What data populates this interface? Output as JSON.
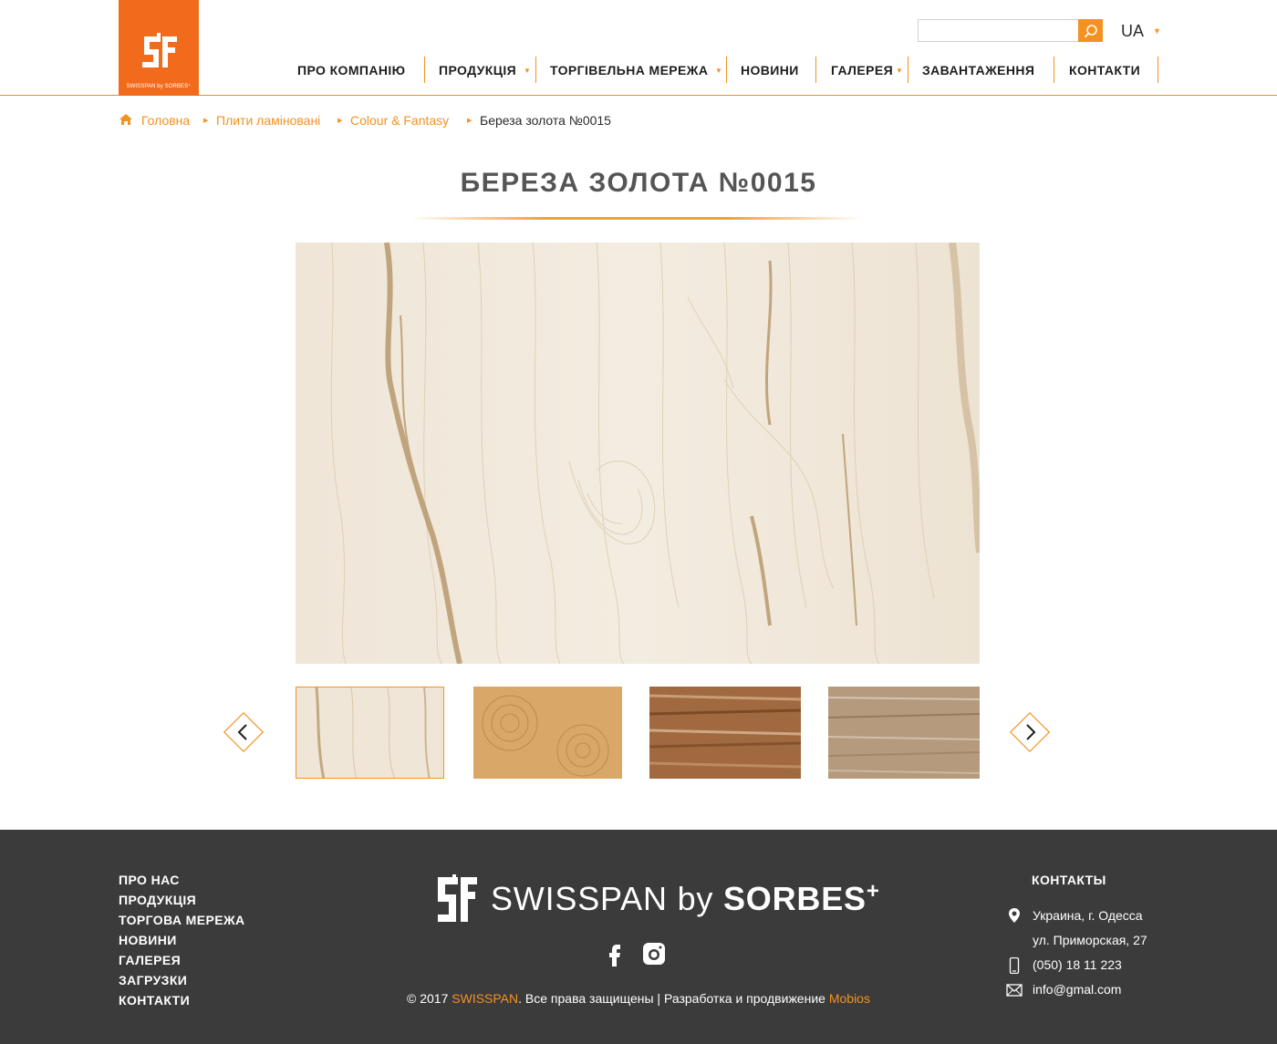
{
  "header": {
    "logo_caption": "SWISSPAN by SORBES⁺",
    "search_placeholder": "",
    "language": "UA",
    "nav": [
      {
        "label": "ПРО КОМПАНІЮ"
      },
      {
        "label": "ПРОДУКЦІЯ"
      },
      {
        "label": "ТОРГІВЕЛЬНА МЕРЕЖА"
      },
      {
        "label": "НОВИНИ"
      },
      {
        "label": "ГАЛЕРЕЯ"
      },
      {
        "label": "ЗАВАНТАЖЕННЯ"
      },
      {
        "label": "КОНТАКТИ"
      }
    ]
  },
  "breadcrumb": {
    "home": "Головна",
    "level1": "Плити ламіновані",
    "level2": "Colour & Fantasy",
    "current": "Береза золота №0015"
  },
  "product": {
    "title": "БЕРЕЗА ЗОЛОТА №0015"
  },
  "footer": {
    "links": [
      {
        "label": "ПРО НАС"
      },
      {
        "label": "ПРОДУКЦІЯ"
      },
      {
        "label": "ТОРГОВА МЕРЕЖА"
      },
      {
        "label": "НОВИНИ"
      },
      {
        "label": "ГАЛЕРЕЯ"
      },
      {
        "label": "ЗАГРУЗКИ"
      },
      {
        "label": "КОНТАКТИ"
      }
    ],
    "brand_light": "SWISSPAN by ",
    "brand_bold": "SORBES",
    "brand_plus": "+",
    "copyright_prefix": "© 2017 ",
    "copyright_brand": "SWISSPAN",
    "copyright_middle": ". Все права защищены | Разработка и продвижение ",
    "copyright_dev": "Mobios",
    "contacts_title": "КОНТАКТЫ",
    "address_line1": "Украина, г. Одесса",
    "address_line2": "ул. Приморская, 27",
    "phone": "(050) 18 11 223",
    "email": "info@gmal.com"
  },
  "colors": {
    "accent": "#f39220",
    "logo_bg": "#f26b1d",
    "footer_bg": "#3b3b3b"
  },
  "icons": [
    "home-icon",
    "search-icon",
    "arrow-left-icon",
    "arrow-right-icon",
    "facebook-icon",
    "instagram-icon",
    "location-pin-icon",
    "phone-icon",
    "mail-icon"
  ]
}
